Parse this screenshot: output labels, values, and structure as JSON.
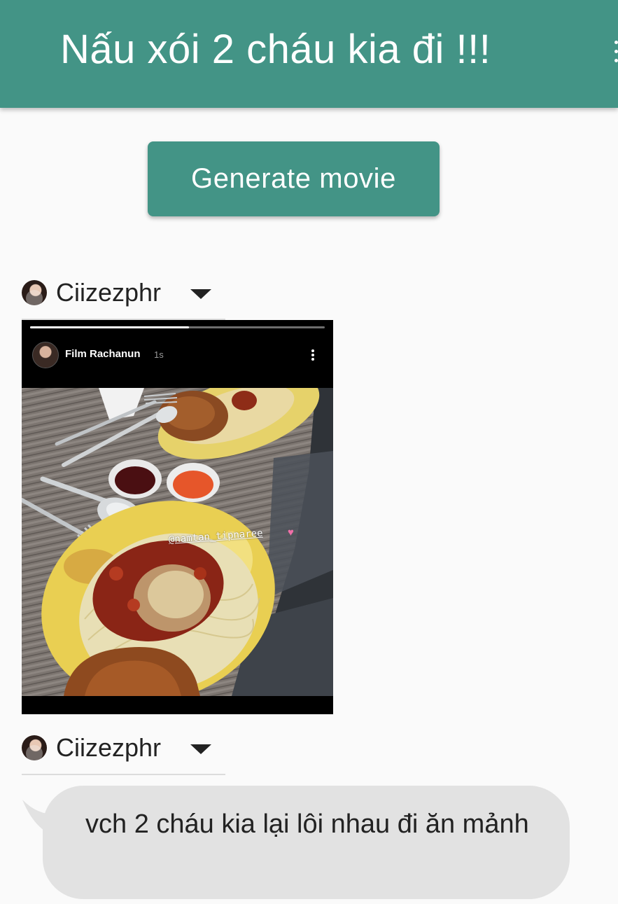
{
  "app_bar": {
    "title": "Nấu xói 2 cháu kia đi !!!",
    "background_color": "#439486",
    "overflow_icon": "more-vert-icon"
  },
  "generate_button": {
    "label": "Generate movie"
  },
  "entries": [
    {
      "sender": {
        "name": "Ciizezphr",
        "dropdown_icon": "caret-down-icon"
      },
      "story": {
        "author": "Film Rachanun",
        "time": "1s",
        "mention": "@namtan_tipnaree",
        "progress": 0.54
      }
    },
    {
      "sender": {
        "name": "Ciizezphr",
        "dropdown_icon": "caret-down-icon"
      },
      "message": {
        "text": "vch 2 cháu kia lại lôi nhau đi ăn mảnh",
        "bubble_color": "#e2e2e2"
      }
    }
  ]
}
